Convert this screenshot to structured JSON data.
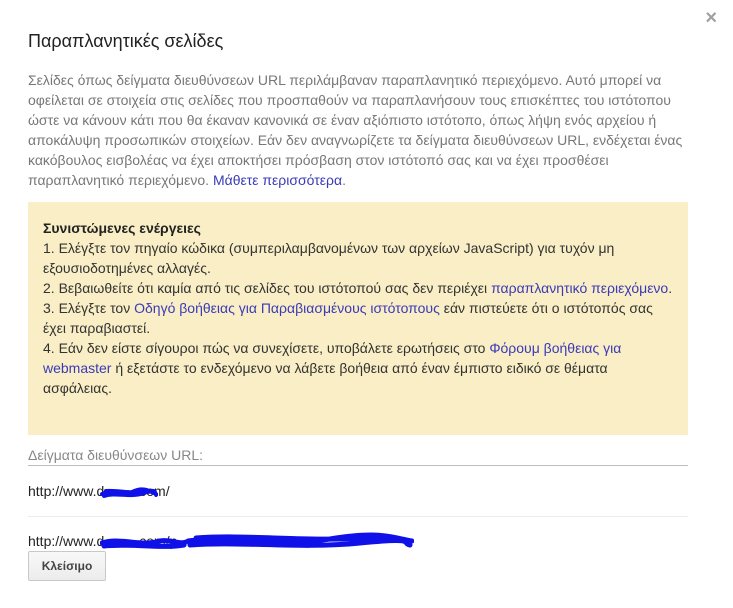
{
  "dialog": {
    "title": "Παραπλανητικές σελίδες",
    "close_icon": "×",
    "intro": {
      "text": "Σελίδες όπως δείγματα διευθύνσεων URL περιλάμβαναν παραπλανητικό περιεχόμενο. Αυτό μπορεί να οφείλεται σε στοιχεία στις σελίδες που προσπαθούν να παραπλανήσουν τους επισκέπτες του ιστότοπου ώστε να κάνουν κάτι που θα έκαναν κανονικά σε έναν αξιόπιστο ιστότοπο, όπως λήψη ενός αρχείου ή αποκάλυψη προσωπικών στοιχείων. Εάν δεν αναγνωρίζετε τα δείγματα διευθύνσεων URL, ενδέχεται ένας κακόβουλος εισβολέας να έχει αποκτήσει πρόσβαση στον ιστότοπό σας και να έχει προσθέσει παραπλανητικό περιεχόμενο.",
      "link": "Μάθετε περισσότερα",
      "after_link": "."
    },
    "actions": {
      "title": "Συνιστώμενες ενέργειες",
      "item1": "1. Ελέγξτε τον πηγαίο κώδικα (συμπεριλαμβανομένων των αρχείων JavaScript) για τυχόν μη εξουσιοδοτημένες αλλαγές.",
      "item2_pre": "2. Βεβαιωθείτε ότι καμία από τις σελίδες του ιστότοπού σας δεν περιέχει ",
      "item2_link": "παραπλανητικό περιεχόμενο",
      "item2_post": ".",
      "item3_pre": "3. Ελέγξτε τον ",
      "item3_link": "Οδηγό βοήθειας για Παραβιασμένους ιστότοπους",
      "item3_post": " εάν πιστεύετε ότι ο ιστότοπός σας έχει παραβιαστεί.",
      "item4_pre": "4. Εάν δεν είστε σίγουροι πώς να συνεχίσετε, υποβάλετε ερωτήσεις στο ",
      "item4_link": "Φόρουμ βοήθειας για webmaster",
      "item4_post": " ή εξετάστε το ενδεχόμενο να λάβετε βοήθεια από έναν έμπιστο ειδικό σε θέματα ασφάλειας."
    },
    "urls": {
      "label": "Δείγματα διευθύνσεων URL:",
      "items": [
        "http://www.d.........com/",
        "http://www.d.........com/p"
      ]
    },
    "close_button": "Κλείσιμο"
  },
  "colors": {
    "link": "#3a3ab8",
    "notice_bg": "#f9eec5",
    "redaction": "#1010e8"
  }
}
